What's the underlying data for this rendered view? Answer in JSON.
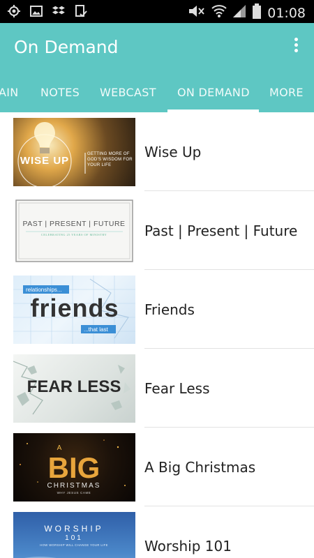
{
  "status_bar": {
    "time": "01:08",
    "icons": [
      "gps-icon",
      "image-icon",
      "dropbox-icon",
      "download-done-icon",
      "mute-icon",
      "wifi-icon",
      "signal-icon",
      "battery-icon"
    ]
  },
  "app_bar": {
    "title": "On Demand",
    "overflow_icon": "more-vert-icon"
  },
  "tabs": [
    {
      "label": "AIN"
    },
    {
      "label": "NOTES"
    },
    {
      "label": "WEBCAST"
    },
    {
      "label": "ON DEMAND",
      "selected": true
    },
    {
      "label": "MORE"
    }
  ],
  "items": [
    {
      "title": "Wise Up",
      "art": {
        "big": "WISE UP",
        "caption": "GETTING MORE OF GOD'S WISDOM FOR YOUR LIFE"
      }
    },
    {
      "title": "Past | Present | Future",
      "art": {
        "big": "PAST | PRESENT | FUTURE",
        "caption": "CELEBRATING 25 YEARS OF MINISTRY"
      }
    },
    {
      "title": "Friends",
      "art": {
        "top": "relationships...",
        "big": "friends",
        "bottom": "...that last"
      }
    },
    {
      "title": "Fear Less",
      "art": {
        "big": "FEAR LESS"
      }
    },
    {
      "title": "A Big Christmas",
      "art": {
        "top": "A",
        "big": "BIG",
        "sub": "CHRISTMAS",
        "caption": "WHY JESUS CAME"
      }
    },
    {
      "title": "Worship 101",
      "art": {
        "big": "WORSHIP",
        "sub": "101",
        "caption": "HOW WORSHIP WILL CHANGE YOUR LIFE"
      }
    }
  ],
  "colors": {
    "accent": "#5ec7c3",
    "status_bar": "#000000",
    "text_primary": "#222222",
    "divider": "#e2e2e2"
  }
}
